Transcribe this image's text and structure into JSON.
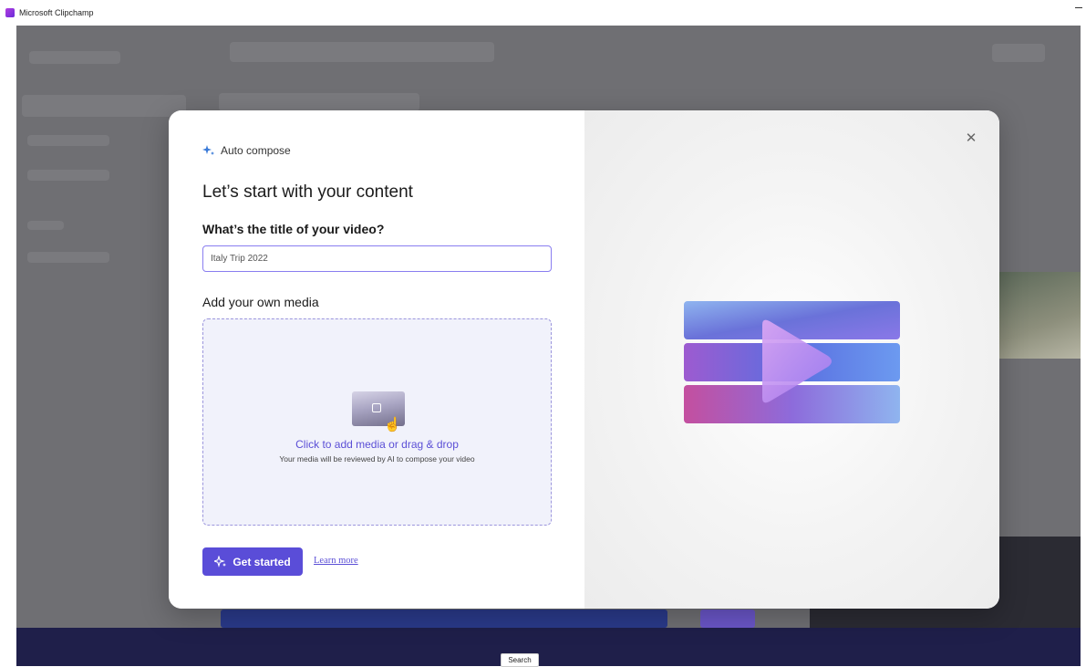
{
  "window": {
    "title": "Microsoft Clipchamp"
  },
  "modal": {
    "header_label": "Auto compose",
    "heading": "Let’s start with your content",
    "title_question": "What’s the title of your video?",
    "title_input_value": "Italy Trip 2022",
    "media_heading": "Add your own media",
    "dropzone": {
      "primary": "Click to add media or drag & drop",
      "secondary": "Your media will be reviewed by AI to compose your video"
    },
    "get_started_label": "Get started",
    "learn_more_label": "Learn more"
  },
  "taskbar": {
    "search_tooltip": "Search"
  },
  "icons": {
    "sparkle": "sparkle-icon",
    "close": "close-icon",
    "media": "media-thumbnail-icon",
    "cursor": "hand-cursor-icon",
    "illustration": "video-play-illustration"
  },
  "colors": {
    "accent": "#5a4dd8",
    "dropzone_bg": "#f1f2fb",
    "link": "#5b4fd6"
  }
}
